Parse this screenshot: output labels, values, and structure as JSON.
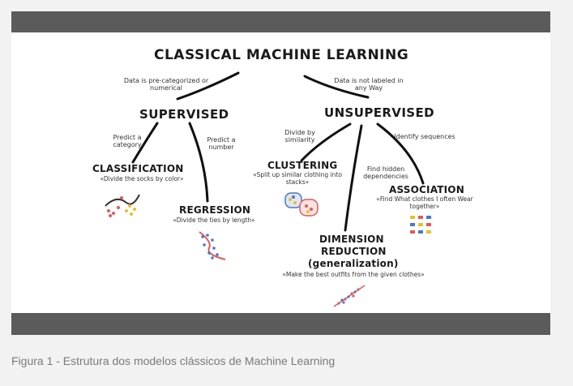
{
  "title": "CLASSICAL MACHINE LEARNING",
  "notes": {
    "supervised_condition": "Data is pre-categorized or numerical",
    "unsupervised_condition": "Data is not labeled in any Way",
    "predict_category": "Predict a category",
    "predict_number": "Predict a number",
    "divide_similarity": "Divide by similarity",
    "identify_sequences": "Identify sequences",
    "find_hidden": "Find hidden dependencies"
  },
  "branches": {
    "supervised": "SUPERVISED",
    "unsupervised": "UNSUPERVISED"
  },
  "nodes": {
    "classification": {
      "label": "CLASSIFICATION",
      "example": "«Divide the socks by color»"
    },
    "regression": {
      "label": "REGRESSION",
      "example": "«Divide the ties by length»"
    },
    "clustering": {
      "label": "CLUSTERING",
      "example": "«Split up similar clothing into stacks»"
    },
    "association": {
      "label": "ASSOCIATION",
      "example": "«Find What clothes I often Wear together»"
    },
    "dimension_reduction": {
      "label_line1": "DIMENSION",
      "label_line2": "REDUCTION",
      "label_line3": "(generalization)",
      "example": "«Make the best outfits from the given clothes»"
    }
  },
  "caption": "Figura 1 - Estrutura dos modelos clássicos de Machine Learning",
  "colors": {
    "frame": "#5b5b5b",
    "ink": "#1a1a1a",
    "accent_red": "#e05a5a",
    "accent_blue": "#4a78c9",
    "accent_yellow": "#e8c12a"
  }
}
